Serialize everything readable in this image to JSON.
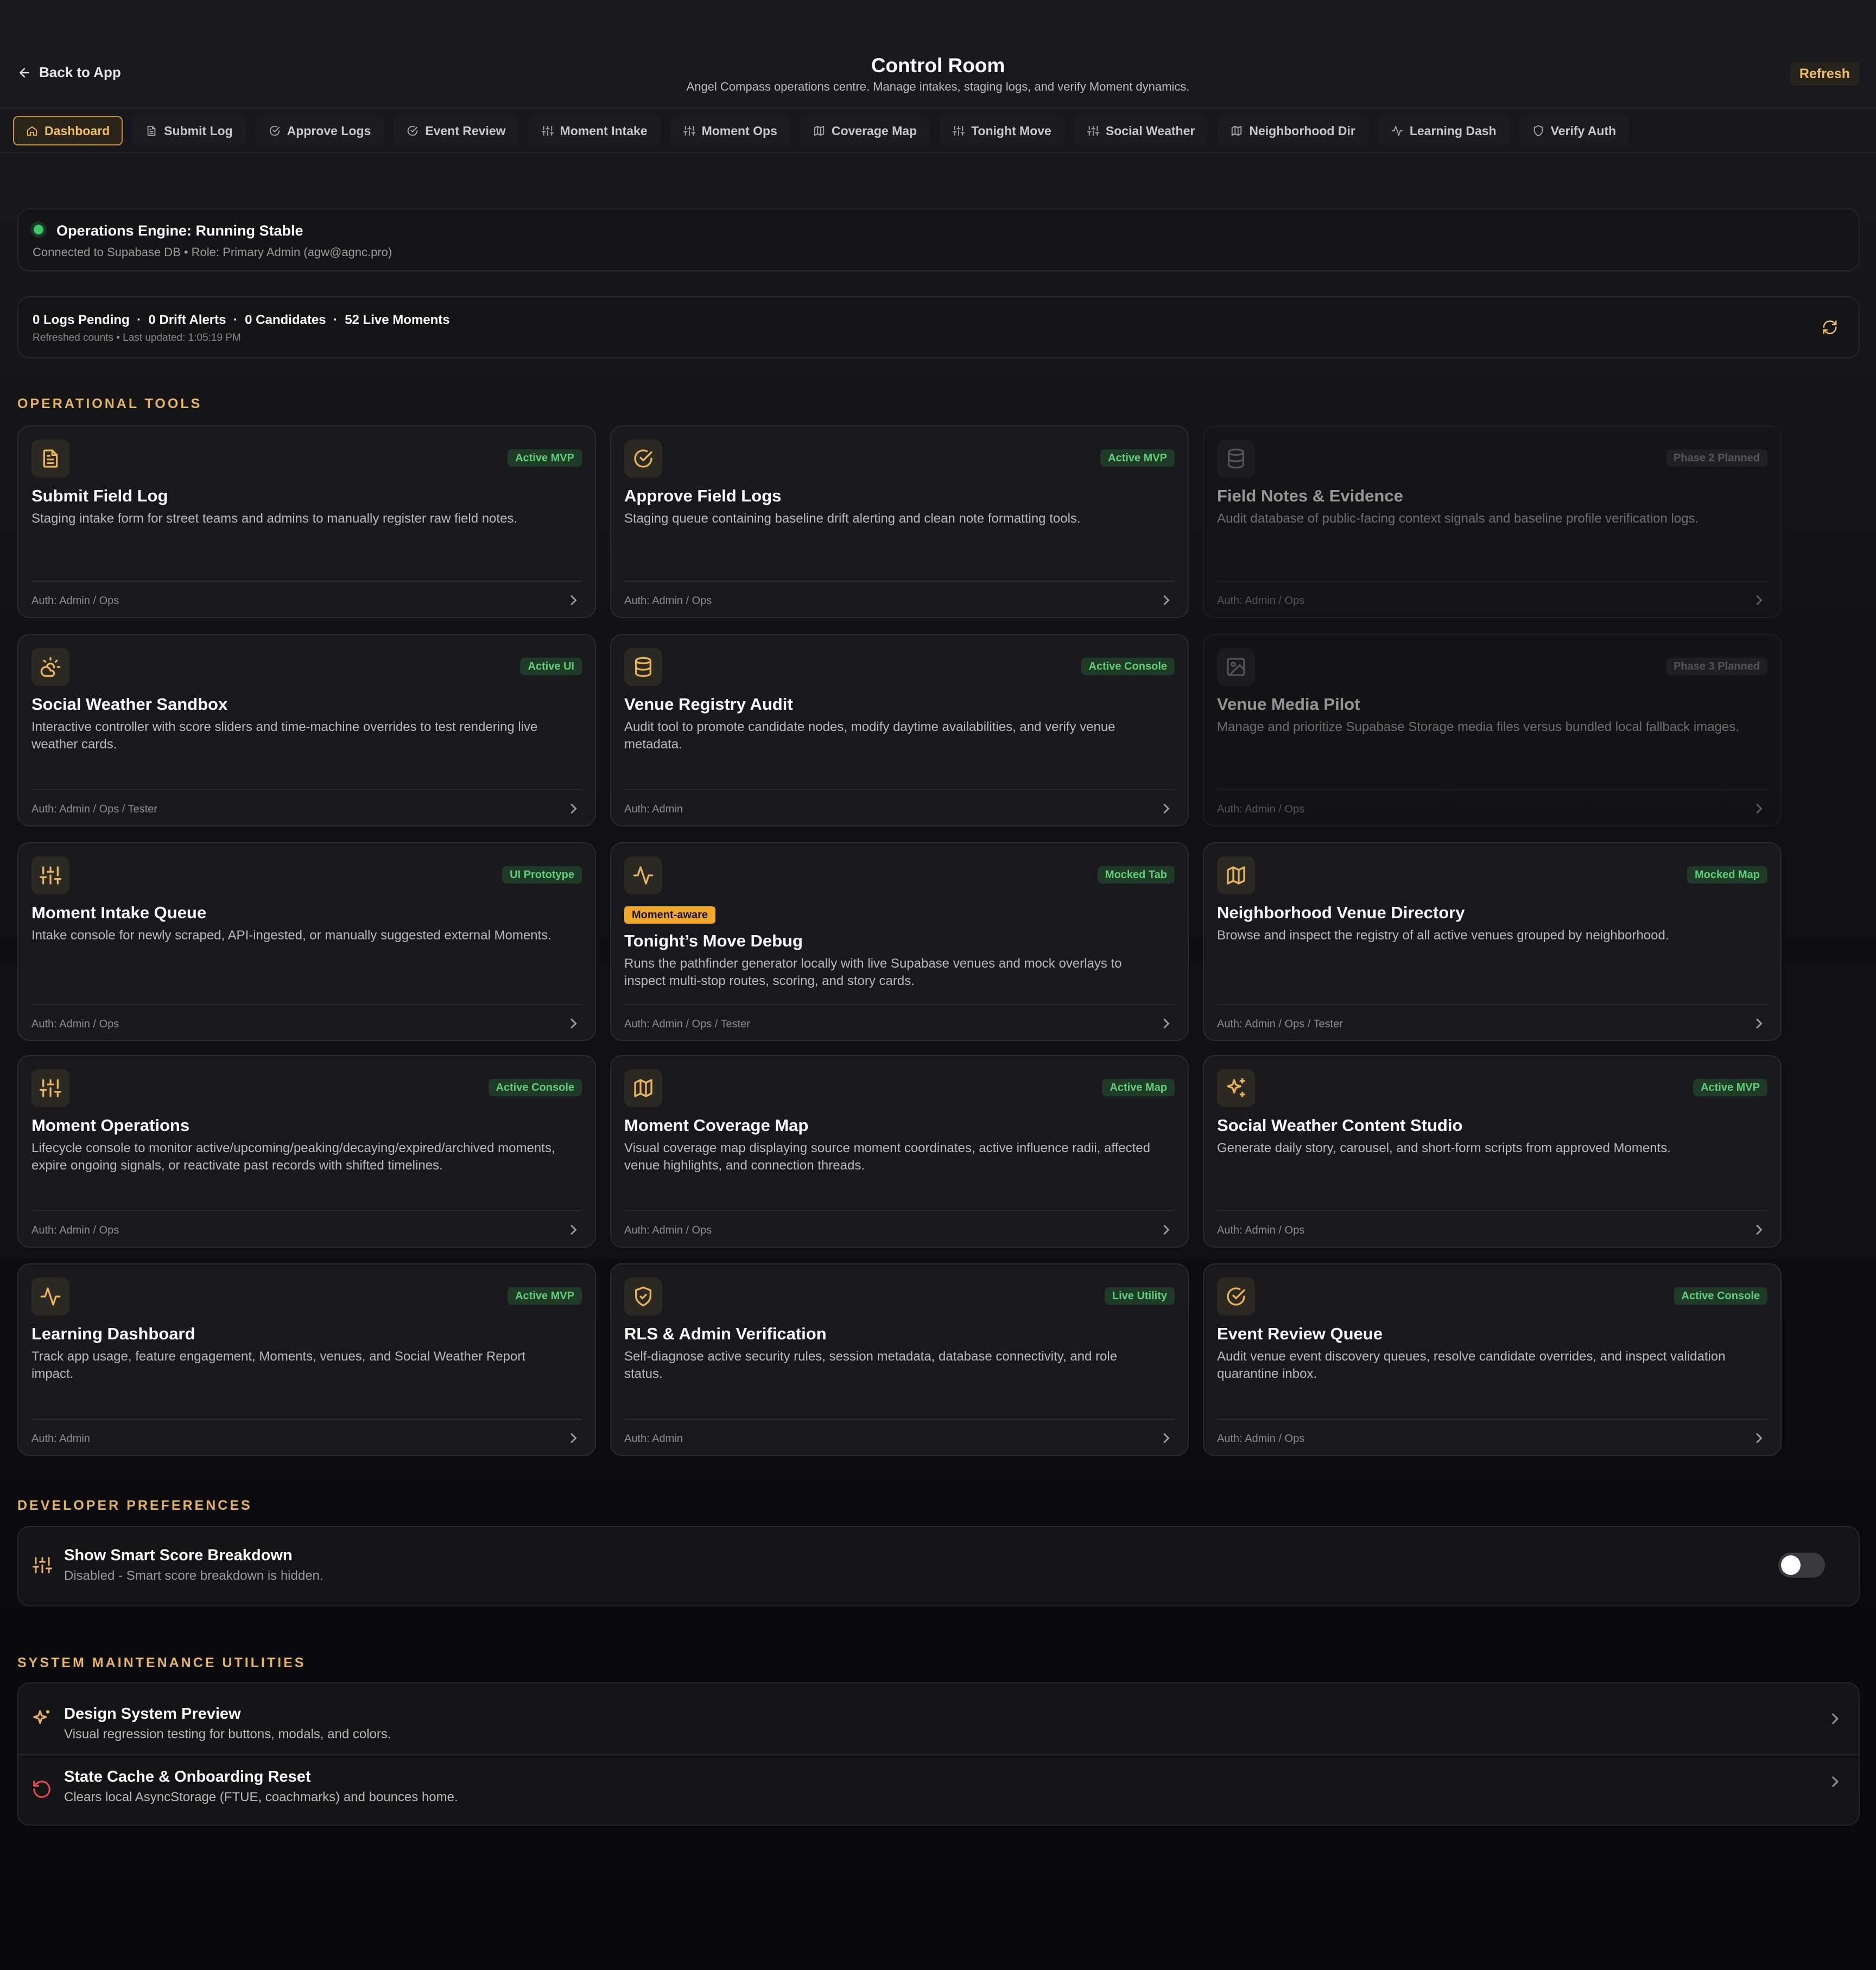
{
  "header": {
    "back_label": "Back to App",
    "title": "Control Room",
    "subtitle": "Angel Compass operations centre. Manage intakes, staging logs, and verify Moment dynamics.",
    "refresh_label": "Refresh"
  },
  "tabs": [
    {
      "label": "Dashboard",
      "icon": "home-icon",
      "active": true
    },
    {
      "label": "Submit Log",
      "icon": "file-icon"
    },
    {
      "label": "Approve Logs",
      "icon": "check-circle-icon"
    },
    {
      "label": "Event Review",
      "icon": "check-circle-icon"
    },
    {
      "label": "Moment Intake",
      "icon": "sliders-icon"
    },
    {
      "label": "Moment Ops",
      "icon": "sliders-icon"
    },
    {
      "label": "Coverage Map",
      "icon": "map-icon"
    },
    {
      "label": "Tonight Move",
      "icon": "sliders-icon"
    },
    {
      "label": "Social Weather",
      "icon": "sliders-icon"
    },
    {
      "label": "Neighborhood Dir",
      "icon": "map-icon"
    },
    {
      "label": "Learning Dash",
      "icon": "activity-icon"
    },
    {
      "label": "Verify Auth",
      "icon": "shield-icon"
    }
  ],
  "status": {
    "title": "Operations Engine: Running Stable",
    "detail": "Connected to Supabase DB • Role: Primary Admin (agw@agnc.pro)",
    "status_color": "#3cc86a"
  },
  "counts": {
    "summary": "0 Logs Pending  ·  0 Drift Alerts  ·  0 Candidates  ·  52 Live Moments",
    "updated": "Refreshed counts • Last updated: 1:05:19 PM"
  },
  "sections": {
    "tools": "OPERATIONAL TOOLS",
    "prefs": "DEVELOPER PREFERENCES",
    "maintenance": "SYSTEM MAINTENANCE UTILITIES"
  },
  "tools": [
    {
      "title": "Submit Field Log",
      "desc": "Staging intake form for street teams and admins to manually register raw field notes.",
      "badge": "Active MVP",
      "auth": "Auth: Admin / Ops",
      "icon": "file-icon"
    },
    {
      "title": "Approve Field Logs",
      "desc": "Staging queue containing baseline drift alerting and clean note formatting tools.",
      "badge": "Active MVP",
      "auth": "Auth: Admin / Ops",
      "icon": "check-circle-icon"
    },
    {
      "title": "Field Notes & Evidence",
      "desc": "Audit database of public-facing context signals and baseline profile verification logs.",
      "badge": "Phase 2 Planned",
      "auth": "Auth: Admin / Ops",
      "icon": "database-icon",
      "dim": true
    },
    {
      "title": "Social Weather Sandbox",
      "desc": "Interactive controller with score sliders and time-machine overrides to test rendering live weather cards.",
      "badge": "Active UI",
      "auth": "Auth: Admin / Ops / Tester",
      "icon": "cloud-sun-icon"
    },
    {
      "title": "Venue Registry Audit",
      "desc": "Audit tool to promote candidate nodes, modify daytime availabilities, and verify venue metadata.",
      "badge": "Active Console",
      "auth": "Auth: Admin",
      "icon": "database-icon"
    },
    {
      "title": "Venue Media Pilot",
      "desc": "Manage and prioritize Supabase Storage media files versus bundled local fallback images.",
      "badge": "Phase 3 Planned",
      "auth": "Auth: Admin / Ops",
      "icon": "image-icon",
      "dim": true
    },
    {
      "title": "Moment Intake Queue",
      "desc": "Intake console for newly scraped, API-ingested, or manually suggested external Moments.",
      "badge": "UI Prototype",
      "auth": "Auth: Admin / Ops",
      "icon": "sliders-icon"
    },
    {
      "title": "Tonight’s Move Debug",
      "desc": "Runs the pathfinder generator locally with live Supabase venues and mock overlays to inspect multi-stop routes, scoring, and story cards.",
      "badge": "Mocked Tab",
      "chip": "Moment-aware",
      "auth": "Auth: Admin / Ops / Tester",
      "icon": "activity-icon"
    },
    {
      "title": "Neighborhood Venue Directory",
      "desc": "Browse and inspect the registry of all active venues grouped by neighborhood.",
      "badge": "Mocked Map",
      "auth": "Auth: Admin / Ops / Tester",
      "icon": "map-icon"
    },
    {
      "title": "Moment Operations",
      "desc": "Lifecycle console to monitor active/upcoming/peaking/decaying/expired/archived moments, expire ongoing signals, or reactivate past records with shifted timelines.",
      "badge": "Active Console",
      "auth": "Auth: Admin / Ops",
      "icon": "sliders-icon"
    },
    {
      "title": "Moment Coverage Map",
      "desc": "Visual coverage map displaying source moment coordinates, active influence radii, affected venue highlights, and connection threads.",
      "badge": "Active Map",
      "auth": "Auth: Admin / Ops",
      "icon": "map-icon"
    },
    {
      "title": "Social Weather Content Studio",
      "desc": "Generate daily story, carousel, and short-form scripts from approved Moments.",
      "badge": "Active MVP",
      "auth": "Auth: Admin / Ops",
      "icon": "sparkles-icon"
    },
    {
      "title": "Learning Dashboard",
      "desc": "Track app usage, feature engagement, Moments, venues, and Social Weather Report impact.",
      "badge": "Active MVP",
      "auth": "Auth: Admin",
      "icon": "activity-icon"
    },
    {
      "title": "RLS & Admin Verification",
      "desc": "Self-diagnose active security rules, session metadata, database connectivity, and role status.",
      "badge": "Live Utility",
      "auth": "Auth: Admin",
      "icon": "shield-check-icon"
    },
    {
      "title": "Event Review Queue",
      "desc": "Audit venue event discovery queues, resolve candidate overrides, and inspect validation quarantine inbox.",
      "badge": "Active Console",
      "auth": "Auth: Admin / Ops",
      "icon": "check-circle-icon"
    }
  ],
  "prefs": {
    "title": "Show Smart Score Breakdown",
    "desc": "Disabled - Smart score breakdown is hidden.",
    "enabled": false
  },
  "maintenance": [
    {
      "title": "Design System Preview",
      "desc": "Visual regression testing for buttons, modals, and colors.",
      "icon": "sparkles-icon",
      "icon_color": "#e7b45e"
    },
    {
      "title": "State Cache & Onboarding Reset",
      "desc": "Clears local AsyncStorage (FTUE, coachmarks) and bounces home.",
      "icon": "reset-icon",
      "icon_color": "#e5484d"
    }
  ],
  "colors": {
    "accent": "#f0c060",
    "badge_green": "#5fd07a",
    "danger": "#e5484d"
  }
}
